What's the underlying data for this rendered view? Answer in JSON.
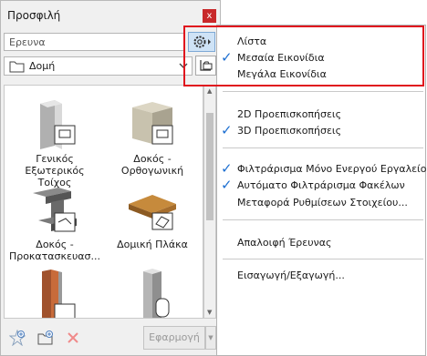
{
  "palette": {
    "title": "Προσφιλή",
    "close_glyph": "x"
  },
  "search": {
    "placeholder": "Ερευνα"
  },
  "folder": {
    "label": "Δομή"
  },
  "favorites": [
    {
      "caption_1": "Γενικός Εξωτερικός",
      "caption_2": "Τοίχος"
    },
    {
      "caption_1": "Δοκός -",
      "caption_2": "Ορθογωνική"
    },
    {
      "caption_1": "Δοκός -",
      "caption_2": "Προκατασκευασ..."
    },
    {
      "caption_1": "Δομική Πλάκα",
      "caption_2": ""
    },
    {
      "caption_1": "",
      "caption_2": ""
    },
    {
      "caption_1": "",
      "caption_2": ""
    }
  ],
  "bottom": {
    "apply_label": "Εφαρμογή"
  },
  "menu": {
    "view_list": "Λίστα",
    "view_medium": "Μεσαία Εικονίδια",
    "view_large": "Μεγάλα Εικονίδια",
    "preview_2d": "2D Προεπισκοπήσεις",
    "preview_3d": "3D Προεπισκοπήσεις",
    "filter_active_tool": "Φιλτράρισμα Μόνο Ενεργού Εργαλείου",
    "auto_filter_folders": "Αυτόματο Φιλτράρισμα Φακέλων",
    "transfer_settings": "Μεταφορά Ρυθμίσεων Στοιχείου...",
    "clear_search": "Απαλοιφή Έρευνας",
    "import_export": "Εισαγωγή/Εξαγωγή..."
  },
  "colors": {
    "accent": "#1d6fd1",
    "highlight_box": "#e0141e",
    "close_bg": "#c8292b"
  }
}
